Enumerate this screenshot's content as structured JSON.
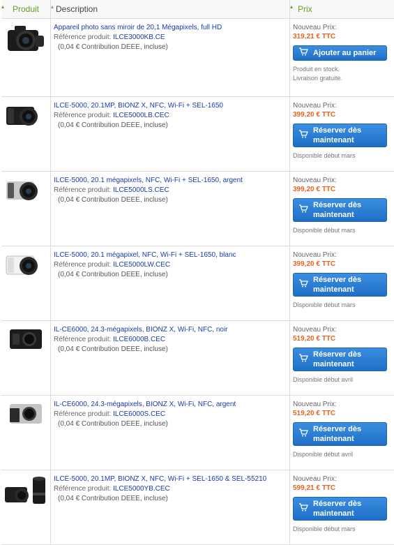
{
  "header": {
    "produit": "Produit",
    "description": "Description",
    "prix": "Prix"
  },
  "colors": {
    "accent_green": "#6a9a1f",
    "link_blue": "#1a3aa8",
    "price_orange": "#e8631c",
    "button_blue": "#2a7ed4"
  },
  "products": [
    {
      "title": "Appareil photo sans miroir de 20,1 Mégapixels, full HD",
      "ref_label": "Référence produit:",
      "ref": "ILCE3000KB.CE",
      "deee": "(0,04 € Contribution DEEE, incluse)",
      "np_label": "Nouveau Prix:",
      "price": "319,21 € TTC",
      "button": "Ajouter au panier",
      "status1": "Produit en stock.",
      "status2": "Livraison gratuite."
    },
    {
      "title": "ILCE-5000, 20.1MP, BIONZ X, NFC, Wi-Fi + SEL-1650",
      "ref_label": "Référence produit:",
      "ref": "ILCE5000LB.CEC",
      "deee": "(0,04 € Contribution DEEE, incluse)",
      "np_label": "Nouveau Prix:",
      "price": "399,20 € TTC",
      "button_l1": "Réserver dès",
      "button_l2": "maintenant",
      "status": "Disponible début mars"
    },
    {
      "title": "ILCE-5000, 20.1 mégapixels, NFC, Wi-Fi + SEL-1650, argent",
      "ref_label": "Référence produit:",
      "ref": "ILCE5000LS.CEC",
      "deee": "(0,04 € Contribution DEEE, incluse)",
      "np_label": "Nouveau Prix:",
      "price": "399,20 € TTC",
      "button_l1": "Réserver dès",
      "button_l2": "maintenant",
      "status": "Disponible début mars"
    },
    {
      "title": "ILCE-5000, 20.1 mégapixel, NFC, Wi-Fi + SEL-1650, blanc",
      "ref_label": "Référence produit:",
      "ref": "ILCE5000LW.CEC",
      "deee": "(0,04 € Contribution DEEE, incluse)",
      "np_label": "Nouveau Prix:",
      "price": "399,20 € TTC",
      "button_l1": "Réserver dès",
      "button_l2": "maintenant",
      "status": "Disponible début mars"
    },
    {
      "title": "IL-CE6000, 24.3-mégapixels, BIONZ X, Wi-Fi, NFC, noir",
      "ref_label": "Référence produit:",
      "ref": "ILCE6000B.CEC",
      "deee": "(0,04 € Contribution DEEE, incluse)",
      "np_label": "Nouveau Prix:",
      "price": "519,20 € TTC",
      "button_l1": "Réserver dès",
      "button_l2": "maintenant",
      "status": "Disponible début avril"
    },
    {
      "title": "IL-CE6000, 24.3-mégapixels, BIONZ X, Wi-Fi, NFC, argent",
      "ref_label": "Référence produit:",
      "ref": "ILCE6000S.CEC",
      "deee": "(0,04 € Contribution DEEE, incluse)",
      "np_label": "Nouveau Prix:",
      "price": "519,20 € TTC",
      "button_l1": "Réserver dès",
      "button_l2": "maintenant",
      "status": "Disponible début avril"
    },
    {
      "title": "ILCE-5000, 20.1MP, BIONZ X, NFC, Wi-Fi + SEL-1650 & SEL-55210",
      "ref_label": "Référence produit:",
      "ref": "ILCE5000YB.CEC",
      "deee": "(0,04 € Contribution DEEE, incluse)",
      "np_label": "Nouveau Prix:",
      "price": "599,21 € TTC",
      "button_l1": "Réserver dès",
      "button_l2": "maintenant",
      "status": "Disponible début mars"
    }
  ]
}
